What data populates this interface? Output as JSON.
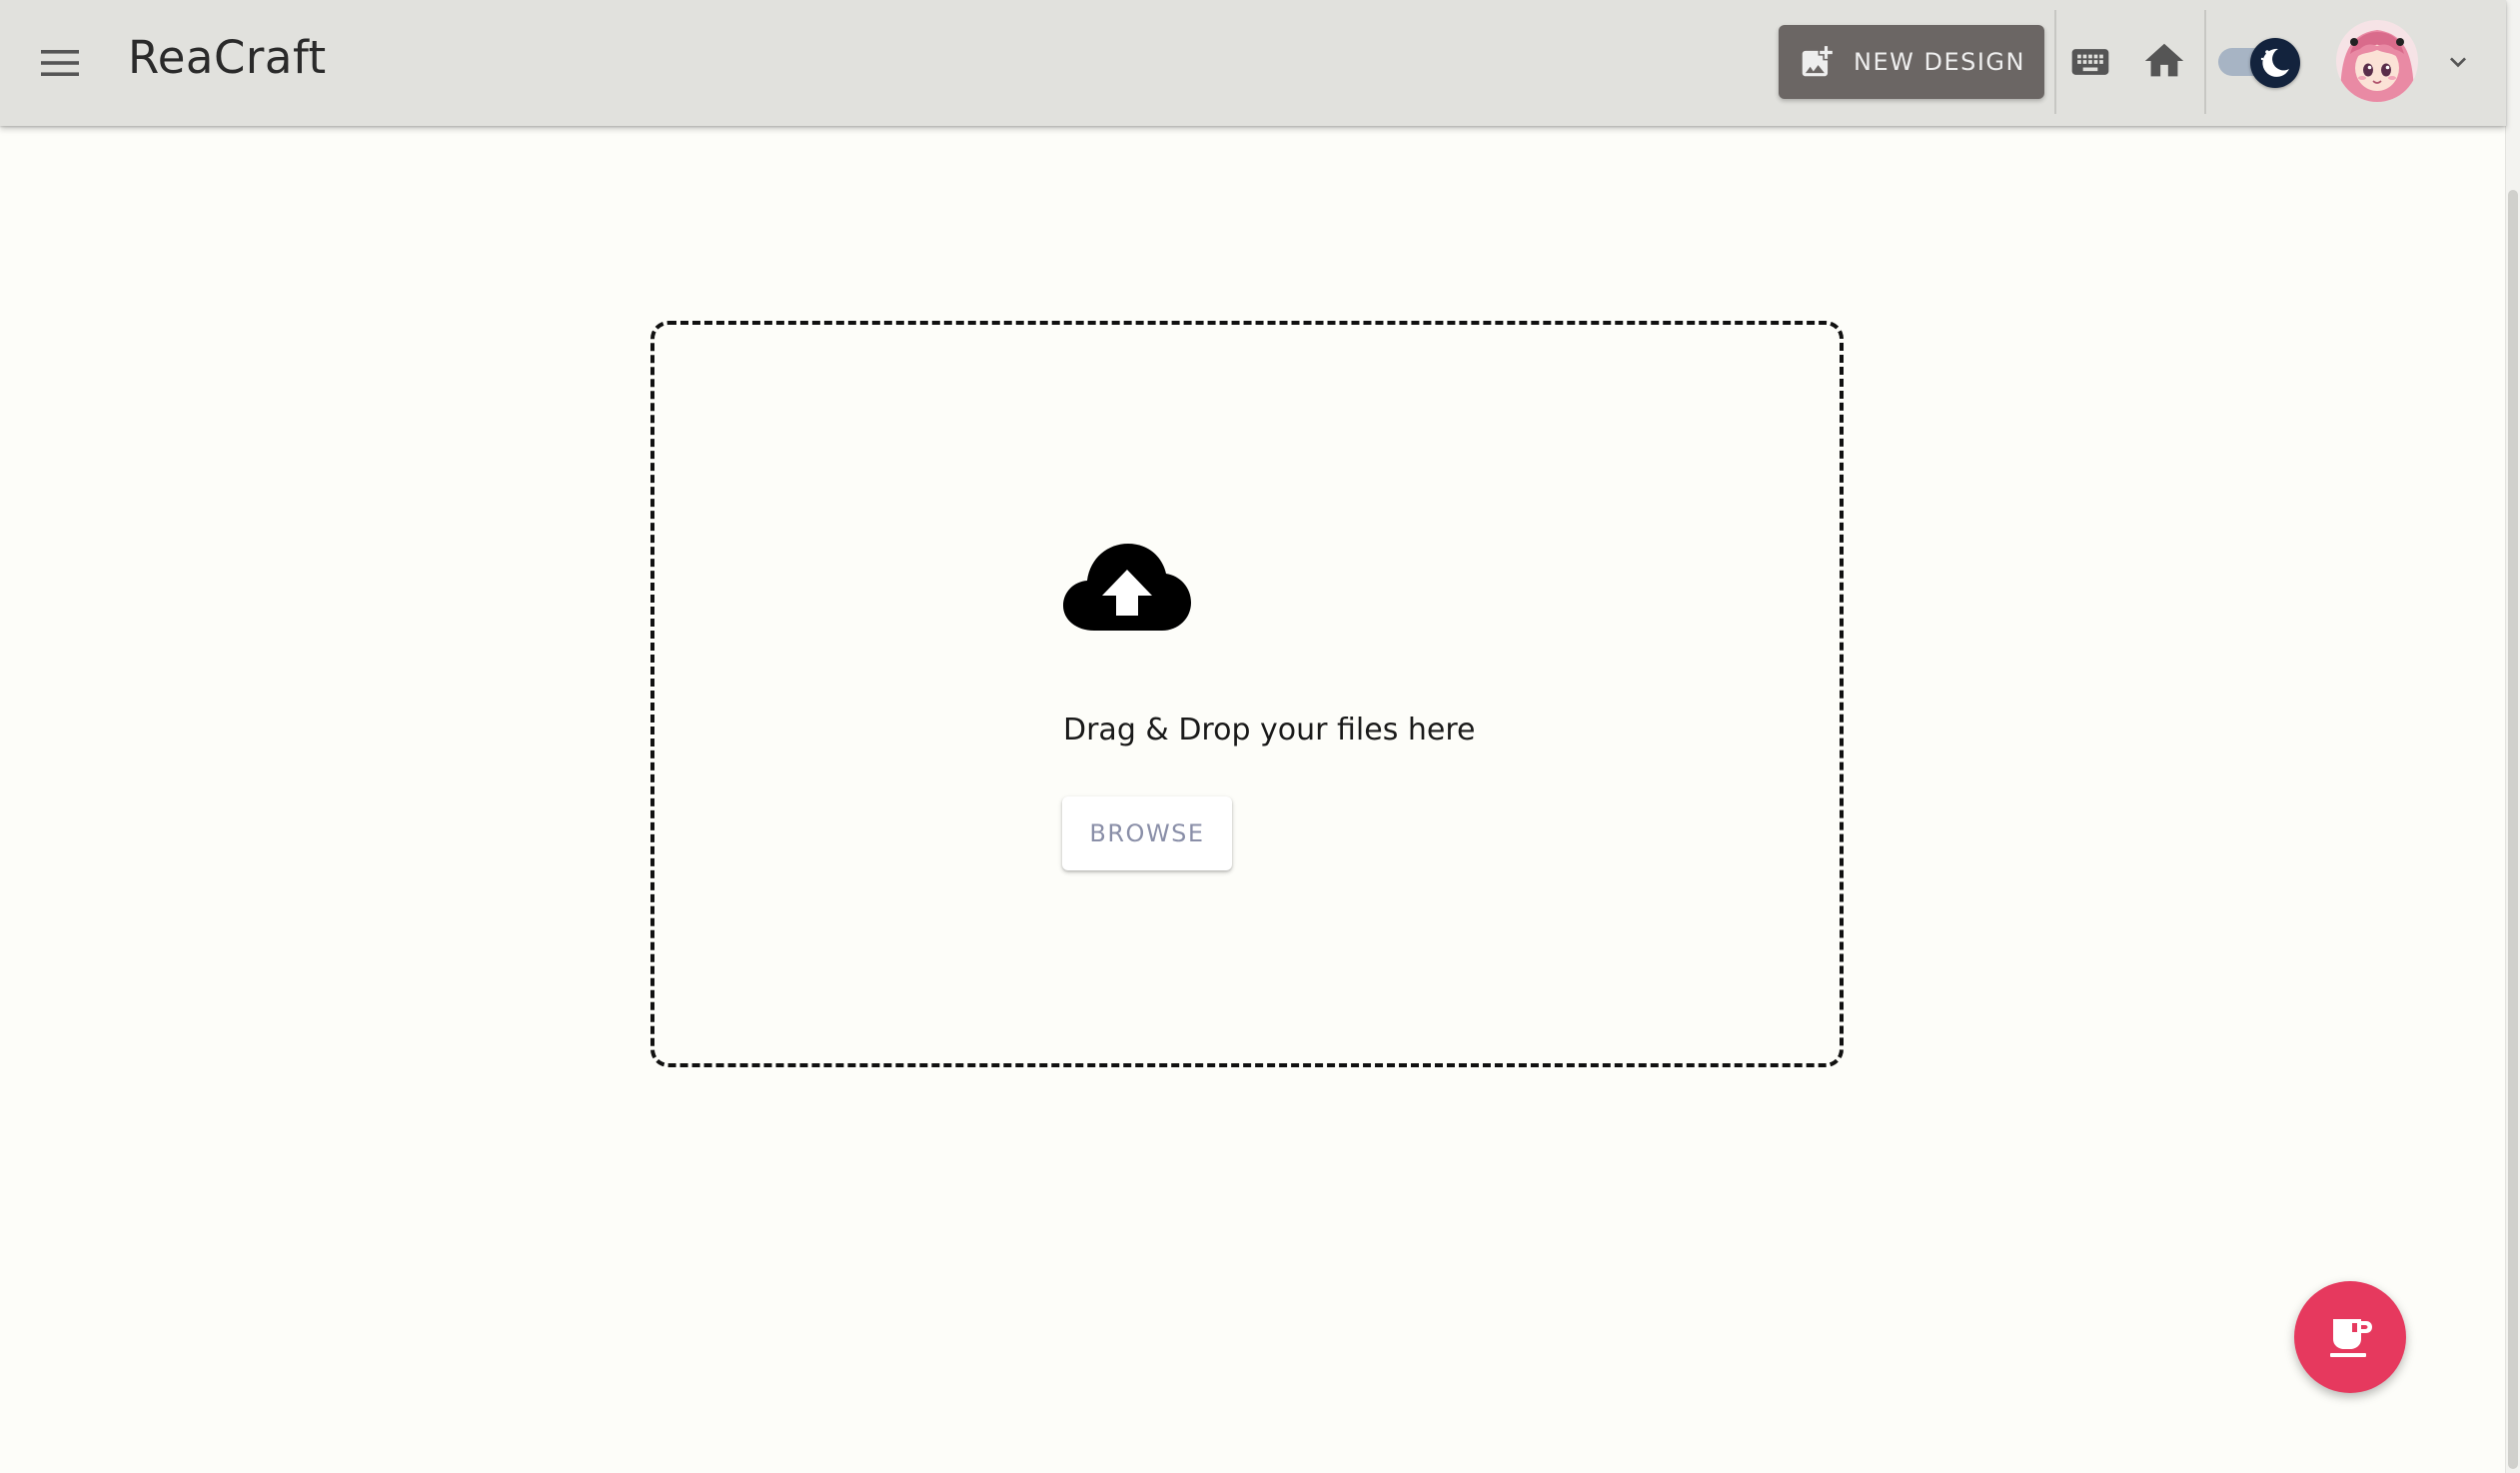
{
  "app": {
    "title": "ReaCraft"
  },
  "header": {
    "menu_icon": "hamburger-menu-icon",
    "new_design_label": "NEW DESIGN",
    "new_design_icon": "add-photo-icon",
    "keyboard_icon": "keyboard-icon",
    "home_icon": "home-icon",
    "theme_toggle": {
      "state": "dark",
      "icon": "moon-icon"
    },
    "avatar_icon": "avatar-image",
    "caret_icon": "chevron-down-icon"
  },
  "upload": {
    "icon": "cloud-upload-icon",
    "prompt": "Drag & Drop your files here",
    "browse_label": "BROWSE"
  },
  "fab": {
    "icon": "coffee-cup-icon"
  },
  "colors": {
    "appbar_bg": "#e1e1dd",
    "page_bg": "#fdfdf9",
    "new_design_bg": "#6b6664",
    "fab_bg": "#e6395e",
    "toggle_thumb": "#13233d",
    "toggle_track": "#a7b4c4"
  }
}
